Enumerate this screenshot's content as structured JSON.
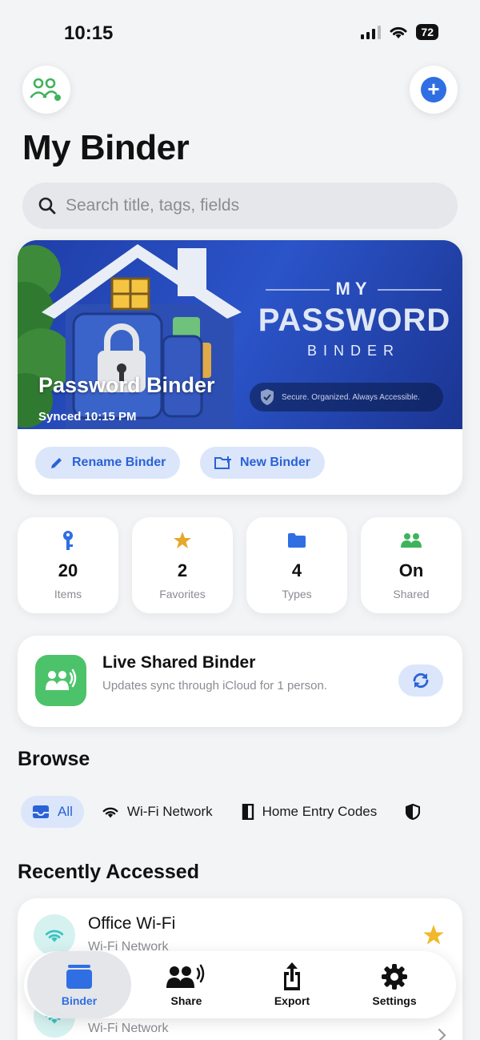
{
  "status_bar": {
    "time": "10:15",
    "battery": "72"
  },
  "header": {
    "title": "My Binder"
  },
  "search": {
    "placeholder": "Search title, tags, fields"
  },
  "binder": {
    "banner_line1": "MY",
    "banner_line2": "PASSWORD",
    "banner_line3": "BINDER",
    "tagline": "Secure. Organized. Always Accessible.",
    "name": "Password Binder",
    "synced": "Synced 10:15 PM",
    "rename_label": "Rename Binder",
    "new_label": "New Binder"
  },
  "stats": [
    {
      "icon": "key-icon",
      "value": "20",
      "label": "Items"
    },
    {
      "icon": "star-icon",
      "value": "2",
      "label": "Favorites"
    },
    {
      "icon": "folder-icon",
      "value": "4",
      "label": "Types"
    },
    {
      "icon": "people-icon",
      "value": "On",
      "label": "Shared"
    }
  ],
  "live_shared": {
    "title": "Live Shared Binder",
    "subtitle": "Updates sync through iCloud for 1 person."
  },
  "browse": {
    "title": "Browse",
    "chips": [
      {
        "icon": "tray-icon",
        "label": "All"
      },
      {
        "icon": "wifi-icon",
        "label": "Wi-Fi Network"
      },
      {
        "icon": "door-icon",
        "label": "Home Entry Codes"
      },
      {
        "icon": "shield-icon",
        "label": ""
      }
    ]
  },
  "recent": {
    "title": "Recently Accessed",
    "items": [
      {
        "title": "Office Wi-Fi",
        "subtitle": "Wi-Fi Network",
        "favorite": true
      },
      {
        "title": "",
        "subtitle": "Wi-Fi Network",
        "favorite": false
      }
    ]
  },
  "tabbar": {
    "tabs": [
      {
        "label": "Binder",
        "icon": "binder-icon",
        "active": true
      },
      {
        "label": "Share",
        "icon": "share-people-icon",
        "active": false
      },
      {
        "label": "Export",
        "icon": "export-icon",
        "active": false
      },
      {
        "label": "Settings",
        "icon": "gear-icon",
        "active": false
      }
    ]
  },
  "colors": {
    "accent": "#2f6fe3",
    "green": "#4cc36a",
    "star": "#f0b92b",
    "teal": "#3cc2c0"
  }
}
